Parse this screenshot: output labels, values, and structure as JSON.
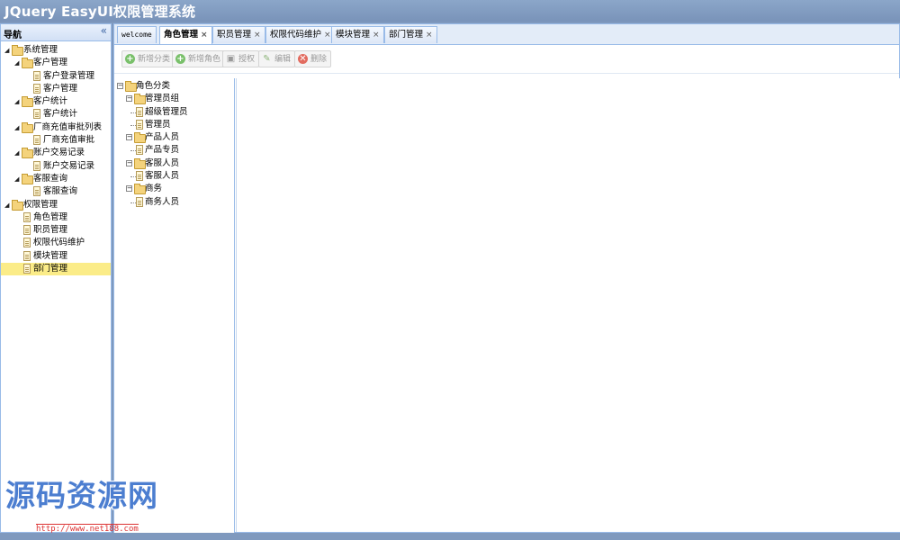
{
  "header": {
    "title": "JQuery EasyUI权限管理系统"
  },
  "nav": {
    "title": "导航",
    "collapse_icon": "«",
    "items": [
      {
        "label": "系统管理",
        "type": "folder",
        "level": 0,
        "expanded": true
      },
      {
        "label": "客户管理",
        "type": "folder",
        "level": 1,
        "expanded": true
      },
      {
        "label": "客户登录管理",
        "type": "doc",
        "level": 2
      },
      {
        "label": "客户管理",
        "type": "doc",
        "level": 2
      },
      {
        "label": "客户统计",
        "type": "folder",
        "level": 1,
        "expanded": true
      },
      {
        "label": "客户统计",
        "type": "doc",
        "level": 2
      },
      {
        "label": "厂商充值审批列表",
        "type": "folder",
        "level": 1,
        "expanded": true
      },
      {
        "label": "厂商充值审批",
        "type": "doc",
        "level": 2
      },
      {
        "label": "账户交易记录",
        "type": "folder",
        "level": 1,
        "expanded": true
      },
      {
        "label": "账户交易记录",
        "type": "doc",
        "level": 2
      },
      {
        "label": "客服查询",
        "type": "folder",
        "level": 1,
        "expanded": true
      },
      {
        "label": "客服查询",
        "type": "doc",
        "level": 2
      },
      {
        "label": "权限管理",
        "type": "folder",
        "level": 0,
        "expanded": true
      },
      {
        "label": "角色管理",
        "type": "doc",
        "level": 1
      },
      {
        "label": "职员管理",
        "type": "doc",
        "level": 1
      },
      {
        "label": "权限代码维护",
        "type": "doc",
        "level": 1
      },
      {
        "label": "模块管理",
        "type": "doc",
        "level": 1
      },
      {
        "label": "部门管理",
        "type": "doc",
        "level": 1,
        "selected": true
      }
    ]
  },
  "tabs": [
    {
      "label": "welcome",
      "closable": false,
      "active": false
    },
    {
      "label": "角色管理",
      "closable": true,
      "active": true
    },
    {
      "label": "职员管理",
      "closable": true,
      "active": false
    },
    {
      "label": "权限代码维护",
      "closable": true,
      "active": false
    },
    {
      "label": "模块管理",
      "closable": true,
      "active": false
    },
    {
      "label": "部门管理",
      "closable": true,
      "active": false
    }
  ],
  "tab_close_glyph": "×",
  "toolbar": {
    "buttons": [
      {
        "label": "新增分类",
        "icon": "add-icon"
      },
      {
        "label": "新增角色",
        "icon": "add-icon"
      },
      {
        "label": "授权",
        "icon": "lock-icon"
      },
      {
        "label": "编辑",
        "icon": "edit-icon"
      },
      {
        "label": "删除",
        "icon": "delete-icon"
      }
    ]
  },
  "role_tree": [
    {
      "label": "角色分类",
      "type": "folder",
      "level": 0
    },
    {
      "label": "管理员组",
      "type": "folder",
      "level": 1
    },
    {
      "label": "超级管理员",
      "type": "doc",
      "level": 2
    },
    {
      "label": "管理员",
      "type": "doc",
      "level": 2
    },
    {
      "label": "产品人员",
      "type": "folder",
      "level": 1
    },
    {
      "label": "产品专员",
      "type": "doc",
      "level": 2
    },
    {
      "label": "客服人员",
      "type": "folder",
      "level": 1
    },
    {
      "label": "客服人员",
      "type": "doc",
      "level": 2
    },
    {
      "label": "商务",
      "type": "folder",
      "level": 1
    },
    {
      "label": "商务人员",
      "type": "doc",
      "level": 2
    }
  ],
  "watermark": {
    "text": "源码资源网",
    "url": "http://www.net188.com"
  },
  "colors": {
    "header": "#7f99be",
    "border": "#99bbe8",
    "selected": "#fbec88"
  }
}
